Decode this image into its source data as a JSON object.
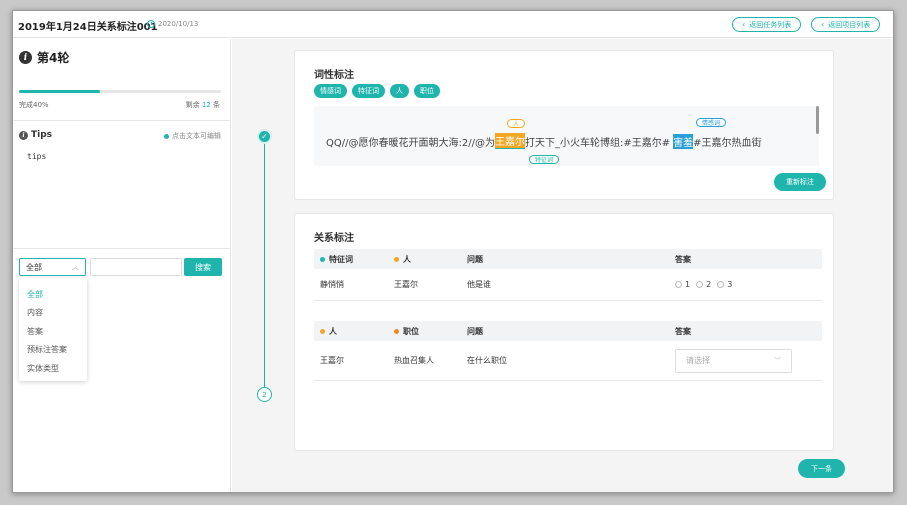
{
  "header": {
    "title": "2019年1月24日关系标注001",
    "date": "2020/10/13",
    "back_task_list": "返回任务列表",
    "back_project_list": "返回项目列表"
  },
  "left": {
    "round_title": "第4轮",
    "progress": {
      "percent": 40,
      "complete_label": "完成40%",
      "remaining_prefix": "剩余",
      "remaining_count": "12",
      "remaining_suffix": "条"
    },
    "tips": {
      "title": "Tips",
      "edit_hint": "点击文本可编辑",
      "content": "tips"
    },
    "filter": {
      "selected": "全部",
      "search_value": "",
      "search_button": "搜索",
      "options": [
        "全部",
        "内容",
        "答案",
        "预标注答案",
        "实体类型"
      ]
    }
  },
  "pos_card": {
    "title": "词性标注",
    "tags": [
      "情感词",
      "特征词",
      "人",
      "职位"
    ],
    "text_segments": {
      "s1": "QQ//@愿你春暖花开面朝大海:2//@为",
      "s2": "王嘉尔",
      "s3": "打天下_小火车轮博组:#王嘉尔#",
      "s4": "害羞",
      "s5": "#王嘉尔热血街"
    },
    "entity_labels": {
      "person": "人",
      "feature": "特征词",
      "emotion": "情感词"
    },
    "reannotate_button": "重新标注"
  },
  "relation_card": {
    "title": "关系标注",
    "table1": {
      "headers": [
        "特征词",
        "人",
        "问题",
        "答案"
      ],
      "row": [
        "静悄悄",
        "王嘉尔",
        "他是谁"
      ],
      "answer_options": [
        "1",
        "2",
        "3"
      ]
    },
    "table2": {
      "headers": [
        "人",
        "职位",
        "问题",
        "答案"
      ],
      "row": [
        "王嘉尔",
        "热血召集人",
        "在什么职位"
      ],
      "answer_placeholder": "请选择"
    }
  },
  "timeline": {
    "step2": "2"
  },
  "next_button": "下一条",
  "colors": {
    "accent": "#1fb5ad",
    "person": "#f5a623",
    "emotion": "#2a9fd6",
    "position_dot": "#f08a24"
  }
}
